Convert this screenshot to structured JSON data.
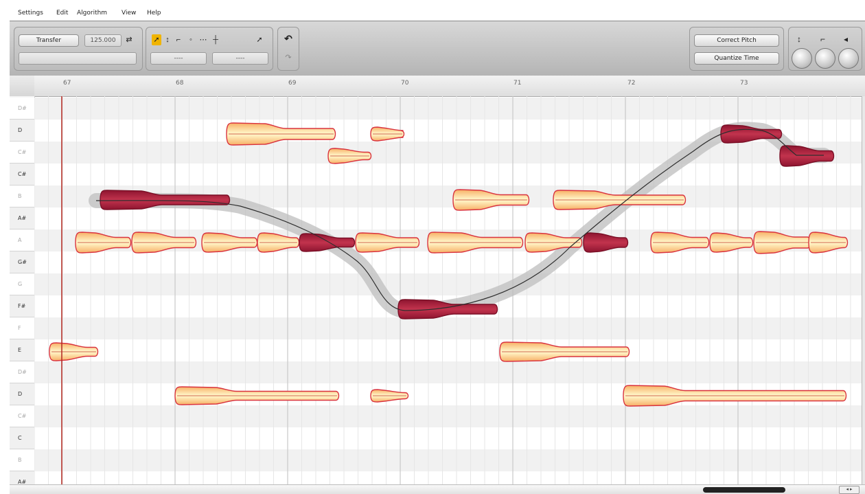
{
  "menu": [
    "Settings",
    "Edit",
    "Algorithm",
    "View",
    "Help"
  ],
  "toolbar": {
    "transfer_label": "Transfer",
    "tempo_value": "125.000",
    "tempo_icon": "link-icon",
    "field_left": "----",
    "field_right": "----",
    "undo_icon": "undo-icon",
    "redo_icon": "redo-icon",
    "correct_pitch_label": "Correct Pitch",
    "quantize_time_label": "Quantize Time",
    "tools": [
      "pointer-icon",
      "pitch-tool-icon",
      "formant-tool-icon",
      "amplitude-tool-icon",
      "note-separation-icon",
      "time-tool-icon"
    ],
    "scroll_tool_icon": "pointer-scroll-icon",
    "knobs": [
      "pitch-drift-knob",
      "formant-knob",
      "amplitude-knob"
    ]
  },
  "ruler": {
    "bars": [
      "67",
      "68",
      "69",
      "70",
      "71",
      "72",
      "73"
    ]
  },
  "keyboard": {
    "notes": [
      "D#",
      "D",
      "C#",
      "C#",
      "B",
      "A#",
      "A",
      "G#",
      "G",
      "F#",
      "F",
      "E",
      "D#",
      "D",
      "C#",
      "C",
      "B",
      "A#"
    ]
  },
  "colors": {
    "blob_fill": "#fce6a8",
    "blob_outline": "#d9323e",
    "blob_selected": "#a51c3a",
    "pitch_curve": "#333333",
    "playhead": "#b2261f",
    "curve_shadow": "#c8c8c8"
  }
}
